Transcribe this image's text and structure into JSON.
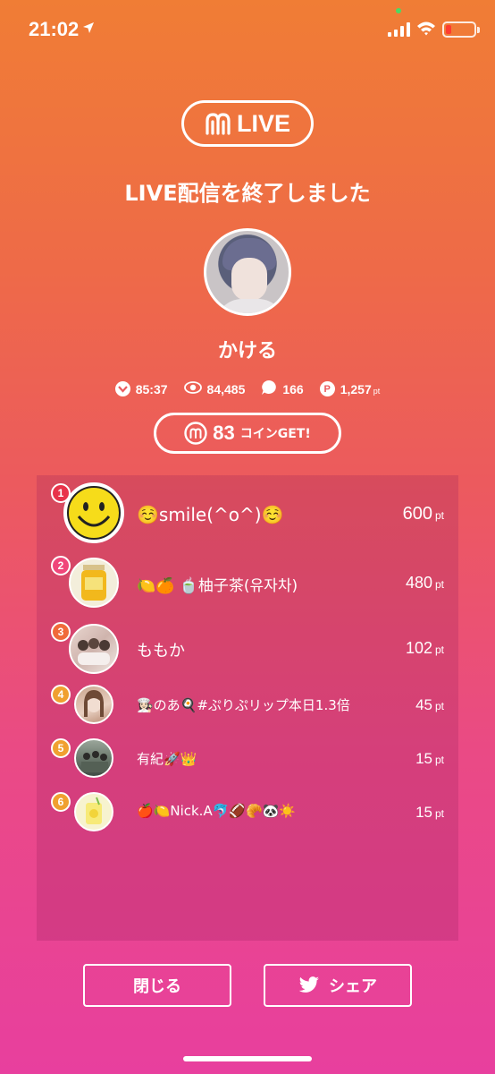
{
  "status_bar": {
    "time": "21:02"
  },
  "header": {
    "logo_text": "LIVE",
    "title": "LIVE配信を終了しました"
  },
  "broadcaster": {
    "name": "かける"
  },
  "stats": {
    "duration": "85:37",
    "viewers": "84,485",
    "comments": "166",
    "points": "1,257",
    "points_unit": "pt"
  },
  "coins": {
    "amount": "83",
    "label": "コインGET!"
  },
  "ranking": [
    {
      "rank": "1",
      "name": "☺️smile(^o^)☺️",
      "points": "600",
      "unit": "pt",
      "rank_color": "#e8324a"
    },
    {
      "rank": "2",
      "name": "🍋🍊 🍵柚子茶(유자차)",
      "points": "480",
      "unit": "pt",
      "rank_color": "#f0467a"
    },
    {
      "rank": "3",
      "name": "ももか",
      "points": "102",
      "unit": "pt",
      "rank_color": "#f06a3a"
    },
    {
      "rank": "4",
      "name": "👩🏻‍🍳のあ🍳#ぷりぷリップ本日1.3倍",
      "points": "45",
      "unit": "pt",
      "rank_color": "#f0a030"
    },
    {
      "rank": "5",
      "name": "有紀🚀👑",
      "points": "15",
      "unit": "pt",
      "rank_color": "#f0a030"
    },
    {
      "rank": "6",
      "name": "🍎🍋Nick.A🐬🏈🥐🐼☀️",
      "points": "15",
      "unit": "pt",
      "rank_color": "#f0a030"
    }
  ],
  "actions": {
    "close_label": "閉じる",
    "share_label": "シェア"
  }
}
